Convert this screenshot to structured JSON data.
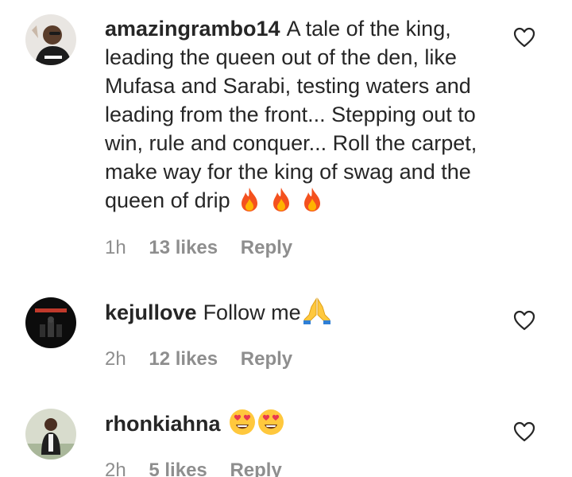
{
  "comments": [
    {
      "username": "amazingrambo14",
      "text": "A tale of the king, leading the queen out of the den, like Mufasa and Sarabi, testing waters and leading from the front... Stepping out to win, rule and conquer... Roll the carpet, make way for the king of swag and the queen of drip",
      "emojis": [
        "fire-icon",
        "fire-icon",
        "fire-icon"
      ],
      "time": "1h",
      "likes": "13 likes",
      "reply": "Reply",
      "avatar_colors": [
        "#e9e6e2",
        "#3a2f2a"
      ]
    },
    {
      "username": "kejullove",
      "text": "Follow me",
      "emojis": [
        "folded-hands-icon"
      ],
      "time": "2h",
      "likes": "12 likes",
      "reply": "Reply",
      "avatar_colors": [
        "#0c0c0c",
        "#c0392b"
      ]
    },
    {
      "username": "rhonkiahna",
      "text": "",
      "emojis": [
        "heart-eyes-emoji-icon",
        "heart-eyes-emoji-icon"
      ],
      "time": "2h",
      "likes": "5 likes",
      "reply": "Reply",
      "avatar_colors": [
        "#d8dccd",
        "#2b2b2b"
      ]
    }
  ],
  "colors": {
    "text": "#262626",
    "meta": "#8e8e8e",
    "fire": "#f4511e",
    "emoji_yellow": "#ffc83d"
  }
}
